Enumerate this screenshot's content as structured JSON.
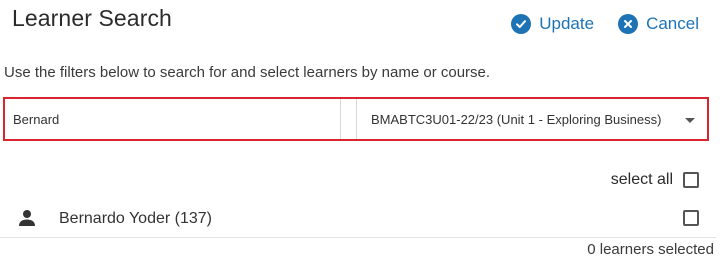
{
  "header": {
    "title": "Learner Search",
    "update_label": "Update",
    "cancel_label": "Cancel"
  },
  "instructions": "Use the filters below to search for and select learners by name or course.",
  "filters": {
    "name_value": "Bernard",
    "course_value": "BMABTC3U01-22/23 (Unit 1 - Exploring Business)"
  },
  "select_all_label": "select all",
  "learners": [
    {
      "label": "Bernardo Yoder (137)",
      "checked": false,
      "icon": "person-icon"
    }
  ],
  "selected_count_text": "0 learners selected",
  "colors": {
    "accent": "#1e73b5",
    "filter_border": "#d9252e"
  }
}
